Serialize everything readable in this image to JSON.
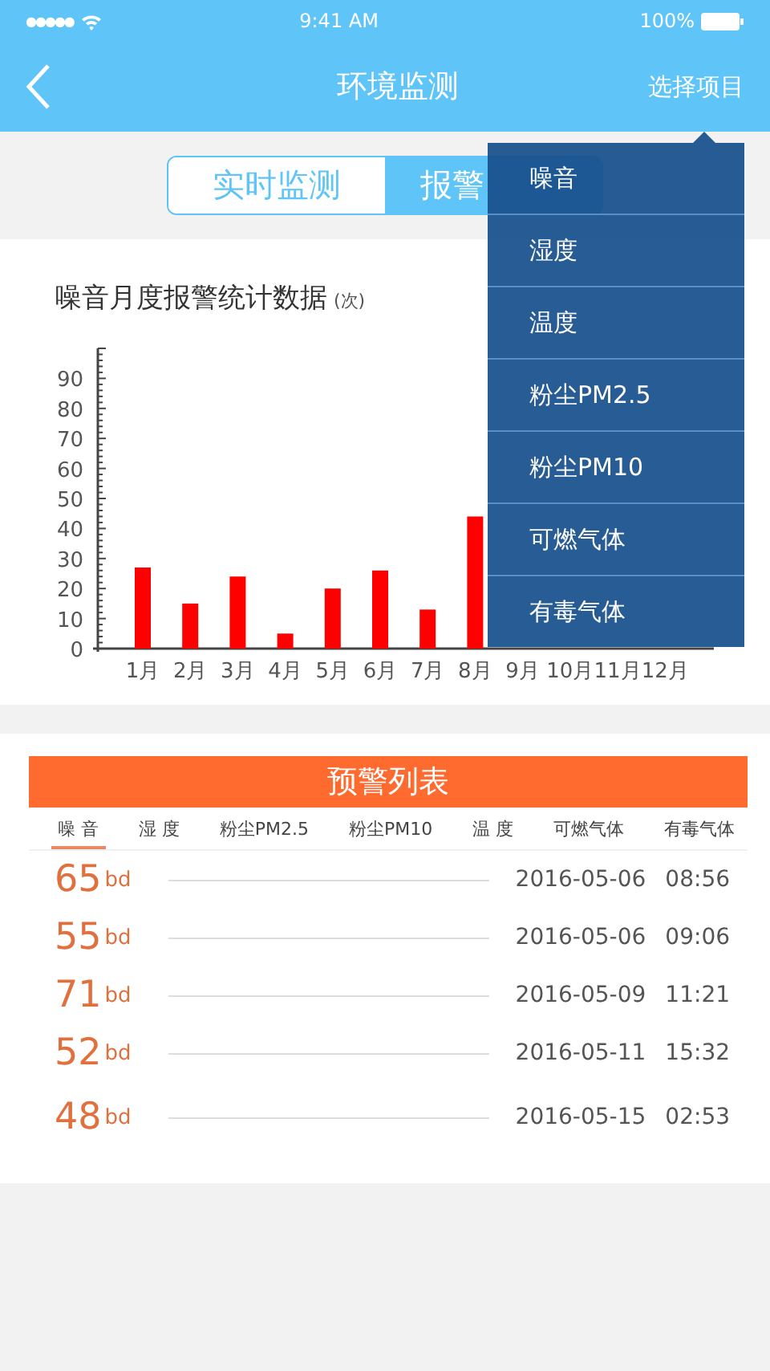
{
  "status_bar": {
    "carrier": "●●●●●",
    "time": "9:41 AM",
    "battery": "100%"
  },
  "nav": {
    "title": "环境监测",
    "action": "选择项目"
  },
  "tabs": [
    {
      "label": "实时监测",
      "selected": false
    },
    {
      "label": "报警",
      "selected": true
    }
  ],
  "chart_card": {
    "title": "噪音月度报警统计数据",
    "unit": "(次)",
    "chart_data": {
      "type": "bar",
      "categories": [
        "1月",
        "2月",
        "3月",
        "4月",
        "5月",
        "6月",
        "7月",
        "8月",
        "9月",
        "10月",
        "11月",
        "12月"
      ],
      "ylim": [
        0,
        100
      ],
      "yticks": [
        0,
        10,
        20,
        30,
        40,
        50,
        60,
        70,
        80,
        90
      ],
      "series": [
        {
          "color": "#ff0000",
          "values": [
            27,
            15,
            24,
            5,
            20,
            26,
            13,
            44,
            null,
            null,
            null,
            null
          ]
        }
      ]
    }
  },
  "dropdown": {
    "items": [
      {
        "label": "噪音"
      },
      {
        "label": "湿度"
      },
      {
        "label": "温度"
      },
      {
        "label": "粉尘PM2.5"
      },
      {
        "label": "粉尘PM10"
      },
      {
        "label": "可燃气体"
      },
      {
        "label": "有毒气体"
      }
    ]
  },
  "alert_list": {
    "title": "预警列表",
    "columns": [
      {
        "label": "噪 音",
        "selected": true
      },
      {
        "label": "湿 度",
        "selected": false
      },
      {
        "label": "粉尘PM2.5",
        "selected": false
      },
      {
        "label": "粉尘PM10",
        "selected": false
      },
      {
        "label": "温 度",
        "selected": false
      },
      {
        "label": "可燃气体",
        "selected": false
      },
      {
        "label": "有毒气体",
        "selected": false
      }
    ],
    "rows": [
      {
        "value": "65",
        "unit": "bd",
        "date": "2016-05-06",
        "time": "08:56"
      },
      {
        "value": "55",
        "unit": "bd",
        "date": "2016-05-06",
        "time": "09:06"
      },
      {
        "value": "71",
        "unit": "bd",
        "date": "2016-05-09",
        "time": "11:21"
      },
      {
        "value": "52",
        "unit": "bd",
        "date": "2016-05-11",
        "time": "15:32"
      },
      {
        "value": "48",
        "unit": "bd",
        "date": "2016-05-15",
        "time": "02:53"
      }
    ]
  }
}
